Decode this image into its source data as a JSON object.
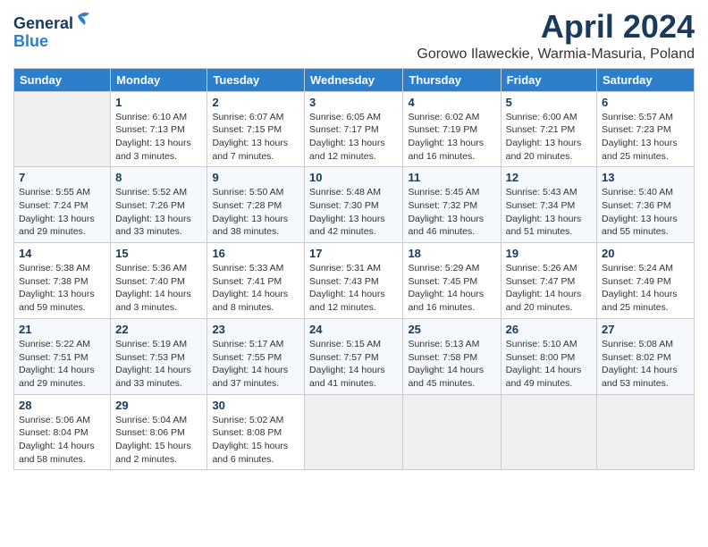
{
  "header": {
    "logo_general": "General",
    "logo_blue": "Blue",
    "month_title": "April 2024",
    "location": "Gorowo Ilaweckie, Warmia-Masuria, Poland"
  },
  "weekdays": [
    "Sunday",
    "Monday",
    "Tuesday",
    "Wednesday",
    "Thursday",
    "Friday",
    "Saturday"
  ],
  "weeks": [
    [
      {
        "day": "",
        "empty": true
      },
      {
        "day": "1",
        "sunrise": "Sunrise: 6:10 AM",
        "sunset": "Sunset: 7:13 PM",
        "daylight": "Daylight: 13 hours and 3 minutes."
      },
      {
        "day": "2",
        "sunrise": "Sunrise: 6:07 AM",
        "sunset": "Sunset: 7:15 PM",
        "daylight": "Daylight: 13 hours and 7 minutes."
      },
      {
        "day": "3",
        "sunrise": "Sunrise: 6:05 AM",
        "sunset": "Sunset: 7:17 PM",
        "daylight": "Daylight: 13 hours and 12 minutes."
      },
      {
        "day": "4",
        "sunrise": "Sunrise: 6:02 AM",
        "sunset": "Sunset: 7:19 PM",
        "daylight": "Daylight: 13 hours and 16 minutes."
      },
      {
        "day": "5",
        "sunrise": "Sunrise: 6:00 AM",
        "sunset": "Sunset: 7:21 PM",
        "daylight": "Daylight: 13 hours and 20 minutes."
      },
      {
        "day": "6",
        "sunrise": "Sunrise: 5:57 AM",
        "sunset": "Sunset: 7:23 PM",
        "daylight": "Daylight: 13 hours and 25 minutes."
      }
    ],
    [
      {
        "day": "7",
        "sunrise": "Sunrise: 5:55 AM",
        "sunset": "Sunset: 7:24 PM",
        "daylight": "Daylight: 13 hours and 29 minutes."
      },
      {
        "day": "8",
        "sunrise": "Sunrise: 5:52 AM",
        "sunset": "Sunset: 7:26 PM",
        "daylight": "Daylight: 13 hours and 33 minutes."
      },
      {
        "day": "9",
        "sunrise": "Sunrise: 5:50 AM",
        "sunset": "Sunset: 7:28 PM",
        "daylight": "Daylight: 13 hours and 38 minutes."
      },
      {
        "day": "10",
        "sunrise": "Sunrise: 5:48 AM",
        "sunset": "Sunset: 7:30 PM",
        "daylight": "Daylight: 13 hours and 42 minutes."
      },
      {
        "day": "11",
        "sunrise": "Sunrise: 5:45 AM",
        "sunset": "Sunset: 7:32 PM",
        "daylight": "Daylight: 13 hours and 46 minutes."
      },
      {
        "day": "12",
        "sunrise": "Sunrise: 5:43 AM",
        "sunset": "Sunset: 7:34 PM",
        "daylight": "Daylight: 13 hours and 51 minutes."
      },
      {
        "day": "13",
        "sunrise": "Sunrise: 5:40 AM",
        "sunset": "Sunset: 7:36 PM",
        "daylight": "Daylight: 13 hours and 55 minutes."
      }
    ],
    [
      {
        "day": "14",
        "sunrise": "Sunrise: 5:38 AM",
        "sunset": "Sunset: 7:38 PM",
        "daylight": "Daylight: 13 hours and 59 minutes."
      },
      {
        "day": "15",
        "sunrise": "Sunrise: 5:36 AM",
        "sunset": "Sunset: 7:40 PM",
        "daylight": "Daylight: 14 hours and 3 minutes."
      },
      {
        "day": "16",
        "sunrise": "Sunrise: 5:33 AM",
        "sunset": "Sunset: 7:41 PM",
        "daylight": "Daylight: 14 hours and 8 minutes."
      },
      {
        "day": "17",
        "sunrise": "Sunrise: 5:31 AM",
        "sunset": "Sunset: 7:43 PM",
        "daylight": "Daylight: 14 hours and 12 minutes."
      },
      {
        "day": "18",
        "sunrise": "Sunrise: 5:29 AM",
        "sunset": "Sunset: 7:45 PM",
        "daylight": "Daylight: 14 hours and 16 minutes."
      },
      {
        "day": "19",
        "sunrise": "Sunrise: 5:26 AM",
        "sunset": "Sunset: 7:47 PM",
        "daylight": "Daylight: 14 hours and 20 minutes."
      },
      {
        "day": "20",
        "sunrise": "Sunrise: 5:24 AM",
        "sunset": "Sunset: 7:49 PM",
        "daylight": "Daylight: 14 hours and 25 minutes."
      }
    ],
    [
      {
        "day": "21",
        "sunrise": "Sunrise: 5:22 AM",
        "sunset": "Sunset: 7:51 PM",
        "daylight": "Daylight: 14 hours and 29 minutes."
      },
      {
        "day": "22",
        "sunrise": "Sunrise: 5:19 AM",
        "sunset": "Sunset: 7:53 PM",
        "daylight": "Daylight: 14 hours and 33 minutes."
      },
      {
        "day": "23",
        "sunrise": "Sunrise: 5:17 AM",
        "sunset": "Sunset: 7:55 PM",
        "daylight": "Daylight: 14 hours and 37 minutes."
      },
      {
        "day": "24",
        "sunrise": "Sunrise: 5:15 AM",
        "sunset": "Sunset: 7:57 PM",
        "daylight": "Daylight: 14 hours and 41 minutes."
      },
      {
        "day": "25",
        "sunrise": "Sunrise: 5:13 AM",
        "sunset": "Sunset: 7:58 PM",
        "daylight": "Daylight: 14 hours and 45 minutes."
      },
      {
        "day": "26",
        "sunrise": "Sunrise: 5:10 AM",
        "sunset": "Sunset: 8:00 PM",
        "daylight": "Daylight: 14 hours and 49 minutes."
      },
      {
        "day": "27",
        "sunrise": "Sunrise: 5:08 AM",
        "sunset": "Sunset: 8:02 PM",
        "daylight": "Daylight: 14 hours and 53 minutes."
      }
    ],
    [
      {
        "day": "28",
        "sunrise": "Sunrise: 5:06 AM",
        "sunset": "Sunset: 8:04 PM",
        "daylight": "Daylight: 14 hours and 58 minutes."
      },
      {
        "day": "29",
        "sunrise": "Sunrise: 5:04 AM",
        "sunset": "Sunset: 8:06 PM",
        "daylight": "Daylight: 15 hours and 2 minutes."
      },
      {
        "day": "30",
        "sunrise": "Sunrise: 5:02 AM",
        "sunset": "Sunset: 8:08 PM",
        "daylight": "Daylight: 15 hours and 6 minutes."
      },
      {
        "day": "",
        "empty": true
      },
      {
        "day": "",
        "empty": true
      },
      {
        "day": "",
        "empty": true
      },
      {
        "day": "",
        "empty": true
      }
    ]
  ]
}
